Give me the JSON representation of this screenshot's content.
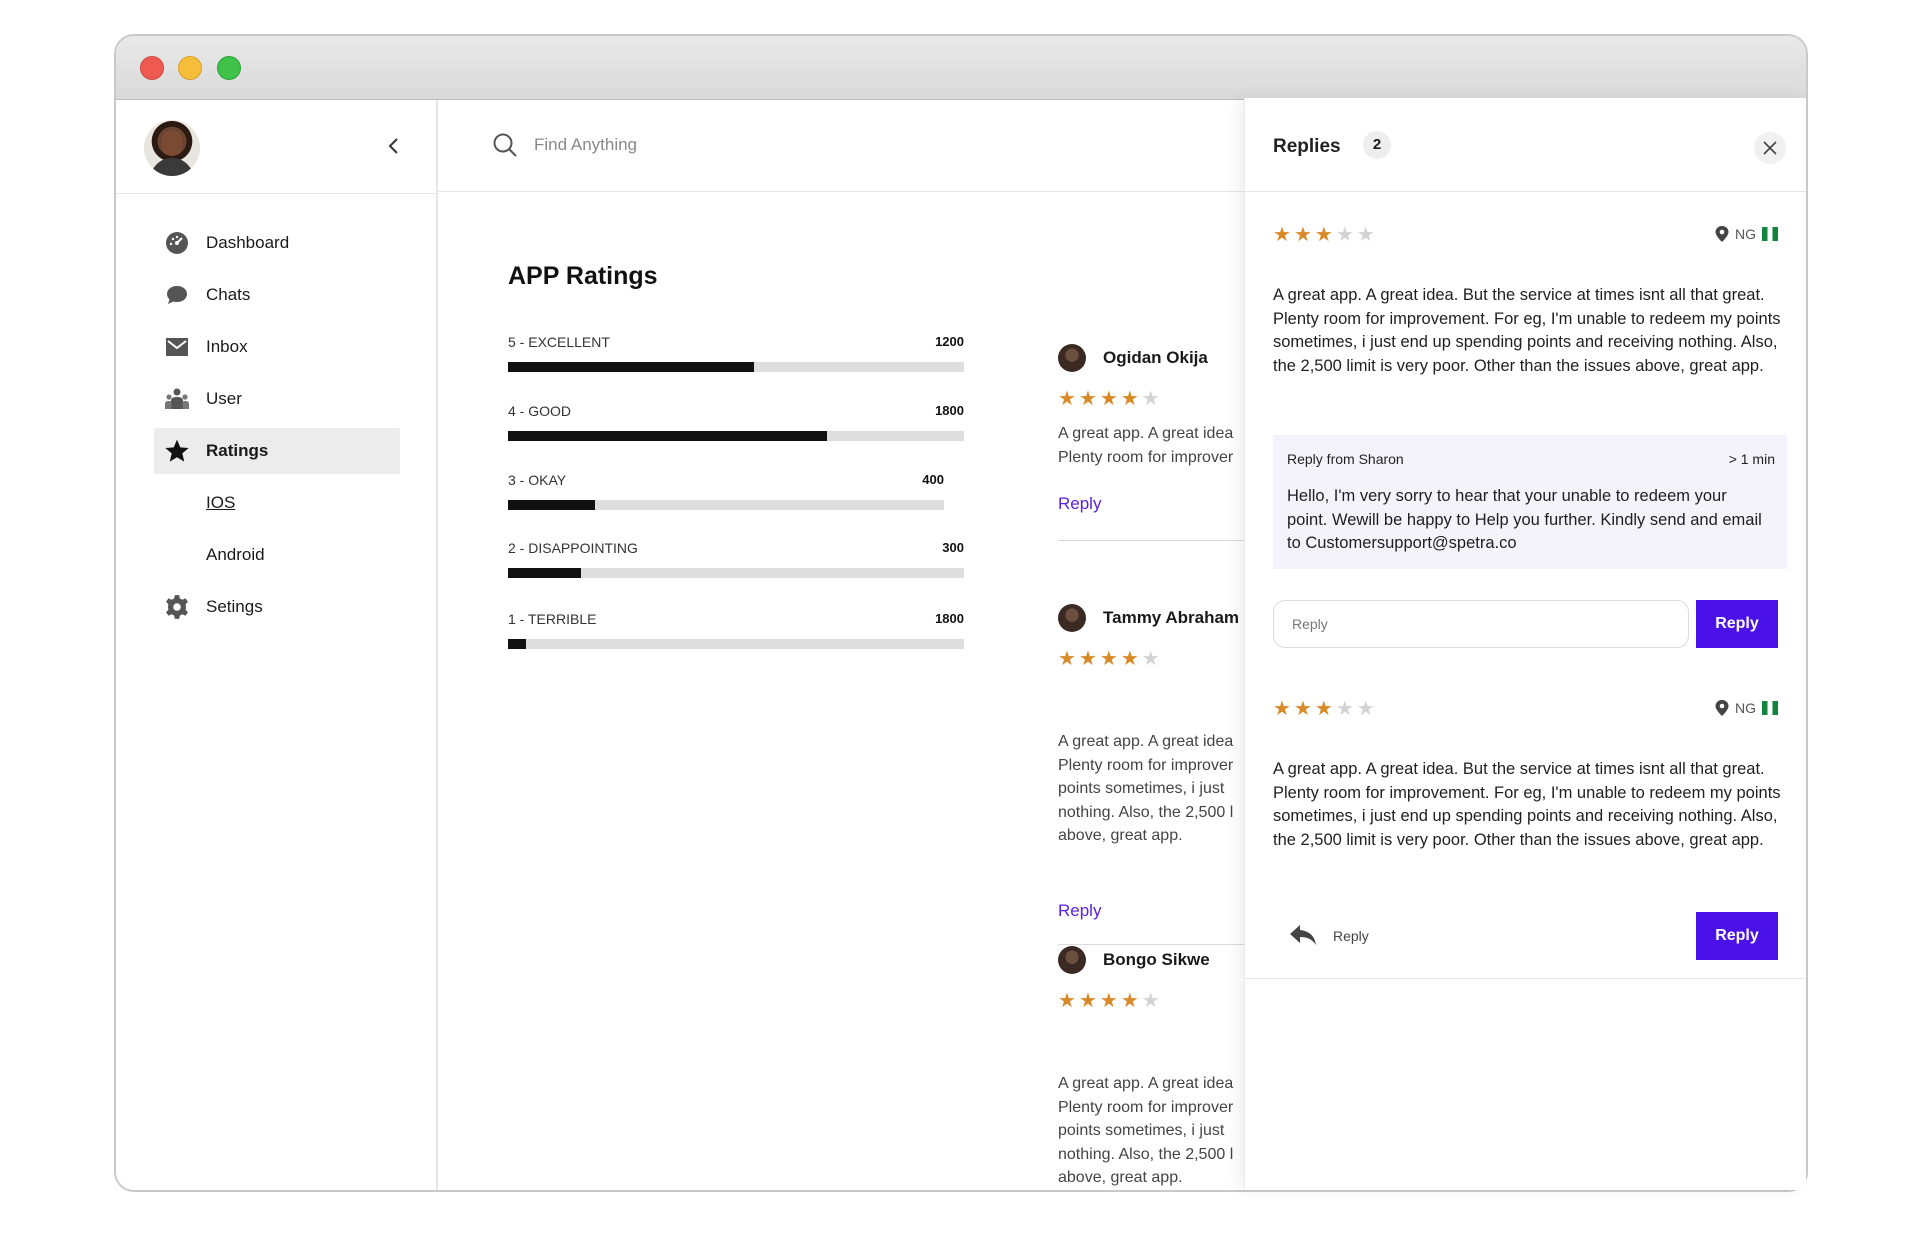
{
  "window": {
    "controls": [
      "close",
      "minimize",
      "maximize"
    ]
  },
  "sidebar": {
    "items": [
      {
        "label": "Dashboard",
        "icon": "dashboard-icon"
      },
      {
        "label": "Chats",
        "icon": "chat-icon"
      },
      {
        "label": "Inbox",
        "icon": "inbox-icon"
      },
      {
        "label": "User",
        "icon": "users-icon"
      },
      {
        "label": "Ratings",
        "icon": "star-icon"
      },
      {
        "label": "IOS"
      },
      {
        "label": "Android"
      },
      {
        "label": "Setings",
        "icon": "gear-icon"
      }
    ],
    "active": "Ratings"
  },
  "search": {
    "placeholder": "Find Anything"
  },
  "ratings": {
    "title": "APP Ratings",
    "rows": [
      {
        "label": "5 - EXCELLENT",
        "count": "1200",
        "fill": 0.54
      },
      {
        "label": "4 - GOOD",
        "count": "1800",
        "fill": 0.7
      },
      {
        "label": "3 - OKAY",
        "count": "400",
        "fill": 0.2
      },
      {
        "label": "2 - DISAPPOINTING",
        "count": "300",
        "fill": 0.16
      },
      {
        "label": "1 - TERRIBLE",
        "count": "1800",
        "fill": 0.04
      }
    ]
  },
  "reviews": [
    {
      "name": "Ogidan Okija",
      "stars": 4,
      "lines": [
        "A great app. A great idea",
        "Plenty room for improver"
      ],
      "reply_label": "Reply"
    },
    {
      "name": "Tammy Abraham",
      "stars": 4,
      "lines": [
        "A great app. A great idea",
        "Plenty room for improver",
        "points sometimes, i just",
        "nothing. Also, the 2,500 l",
        "above, great app."
      ],
      "reply_label": "Reply"
    },
    {
      "name": "Bongo Sikwe",
      "stars": 4,
      "lines": [
        "A great app. A great idea",
        "Plenty room for improver",
        "points sometimes, i just",
        "nothing. Also, the 2,500 l",
        "above, great app."
      ],
      "reply_label": "Reply"
    }
  ],
  "panel": {
    "title": "Replies",
    "count": "2",
    "entries": [
      {
        "stars": 3,
        "country": "NG",
        "text": "A great app. A great idea. But the service at times isnt all that great. Plenty room for improvement. For eg, I'm unable to redeem my points sometimes, i just end up spending points and receiving nothing. Also, the 2,500 limit is very poor. Other than the issues above, great app.",
        "reply_from": "Reply from Sharon",
        "reply_time": "> 1 min",
        "reply_text": "Hello, I'm very sorry to hear that your unable to redeem your point. Wewill be happy to Help you further. Kindly send and email to Customersupport@spetra.co",
        "input_placeholder": "Reply",
        "button_label": "Reply"
      },
      {
        "stars": 3,
        "country": "NG",
        "text": "A great app. A great idea. But the service at times isnt all that great. Plenty room for improvement. For eg, I'm unable to redeem my points sometimes, i just end up spending points and receiving nothing. Also, the 2,500 limit is very poor. Other than the issues above, great app.",
        "reply_link": "Reply",
        "button_label": "Reply"
      }
    ]
  },
  "colors": {
    "accent": "#4a12e8",
    "star": "#d98a28",
    "link": "#5a1fe0",
    "bar": "#111111"
  }
}
